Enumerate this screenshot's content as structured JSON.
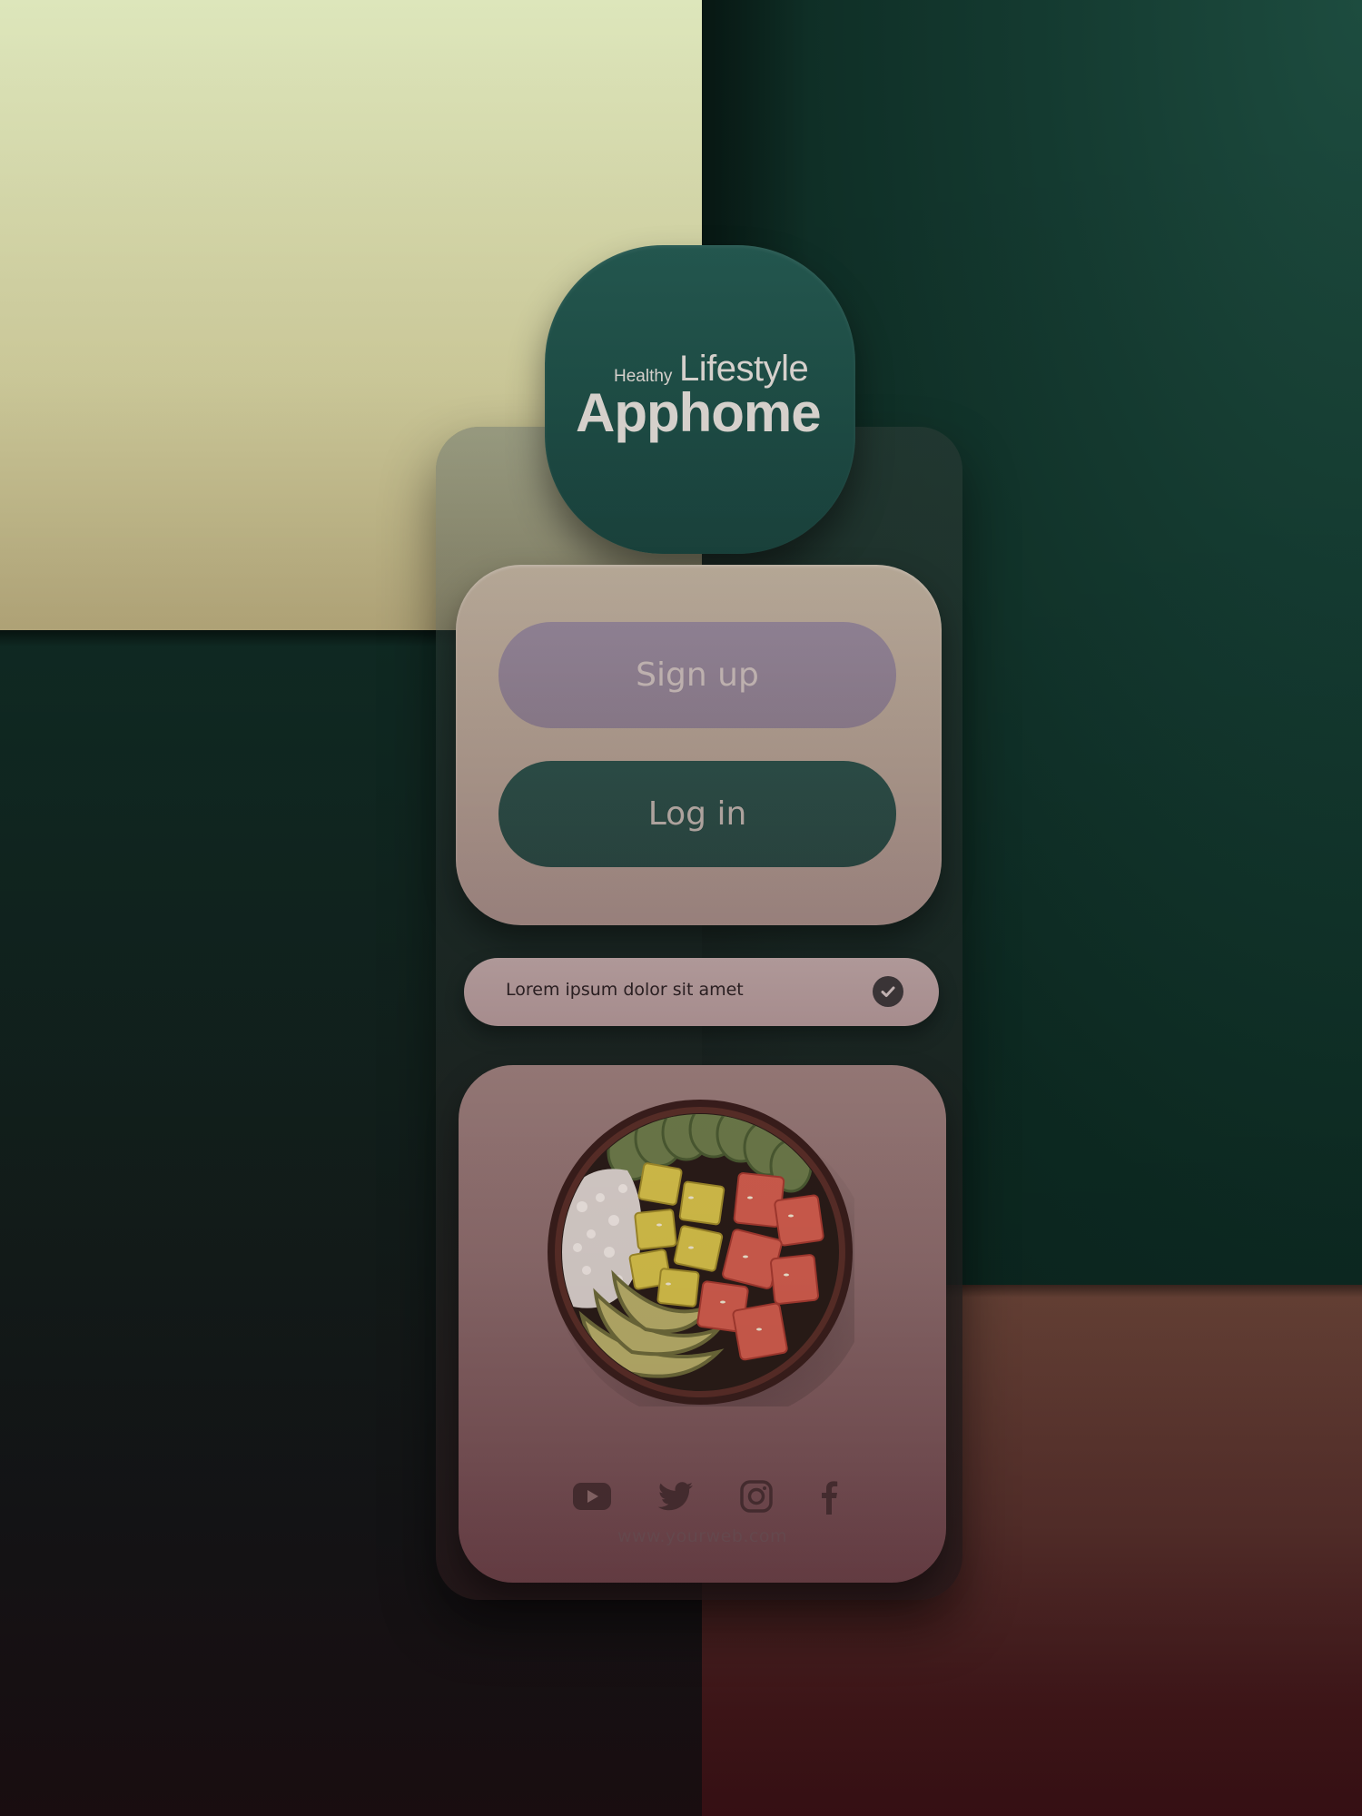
{
  "brand": {
    "small": "Healthy",
    "word": "Lifestyle",
    "name": "Apphome"
  },
  "auth": {
    "signup_label": "Sign up",
    "login_label": "Log in"
  },
  "agreement": {
    "text": "Lorem ipsum dolor sit amet",
    "checked": true
  },
  "footer": {
    "socials": [
      "youtube-icon",
      "twitter-icon",
      "instagram-icon",
      "facebook-icon"
    ],
    "website": "www.yourweb.com"
  },
  "colors": {
    "teal": "#1d4a43",
    "signup": "#8a7a8a",
    "cream": "#dde6bb",
    "wine": "#43171a"
  }
}
